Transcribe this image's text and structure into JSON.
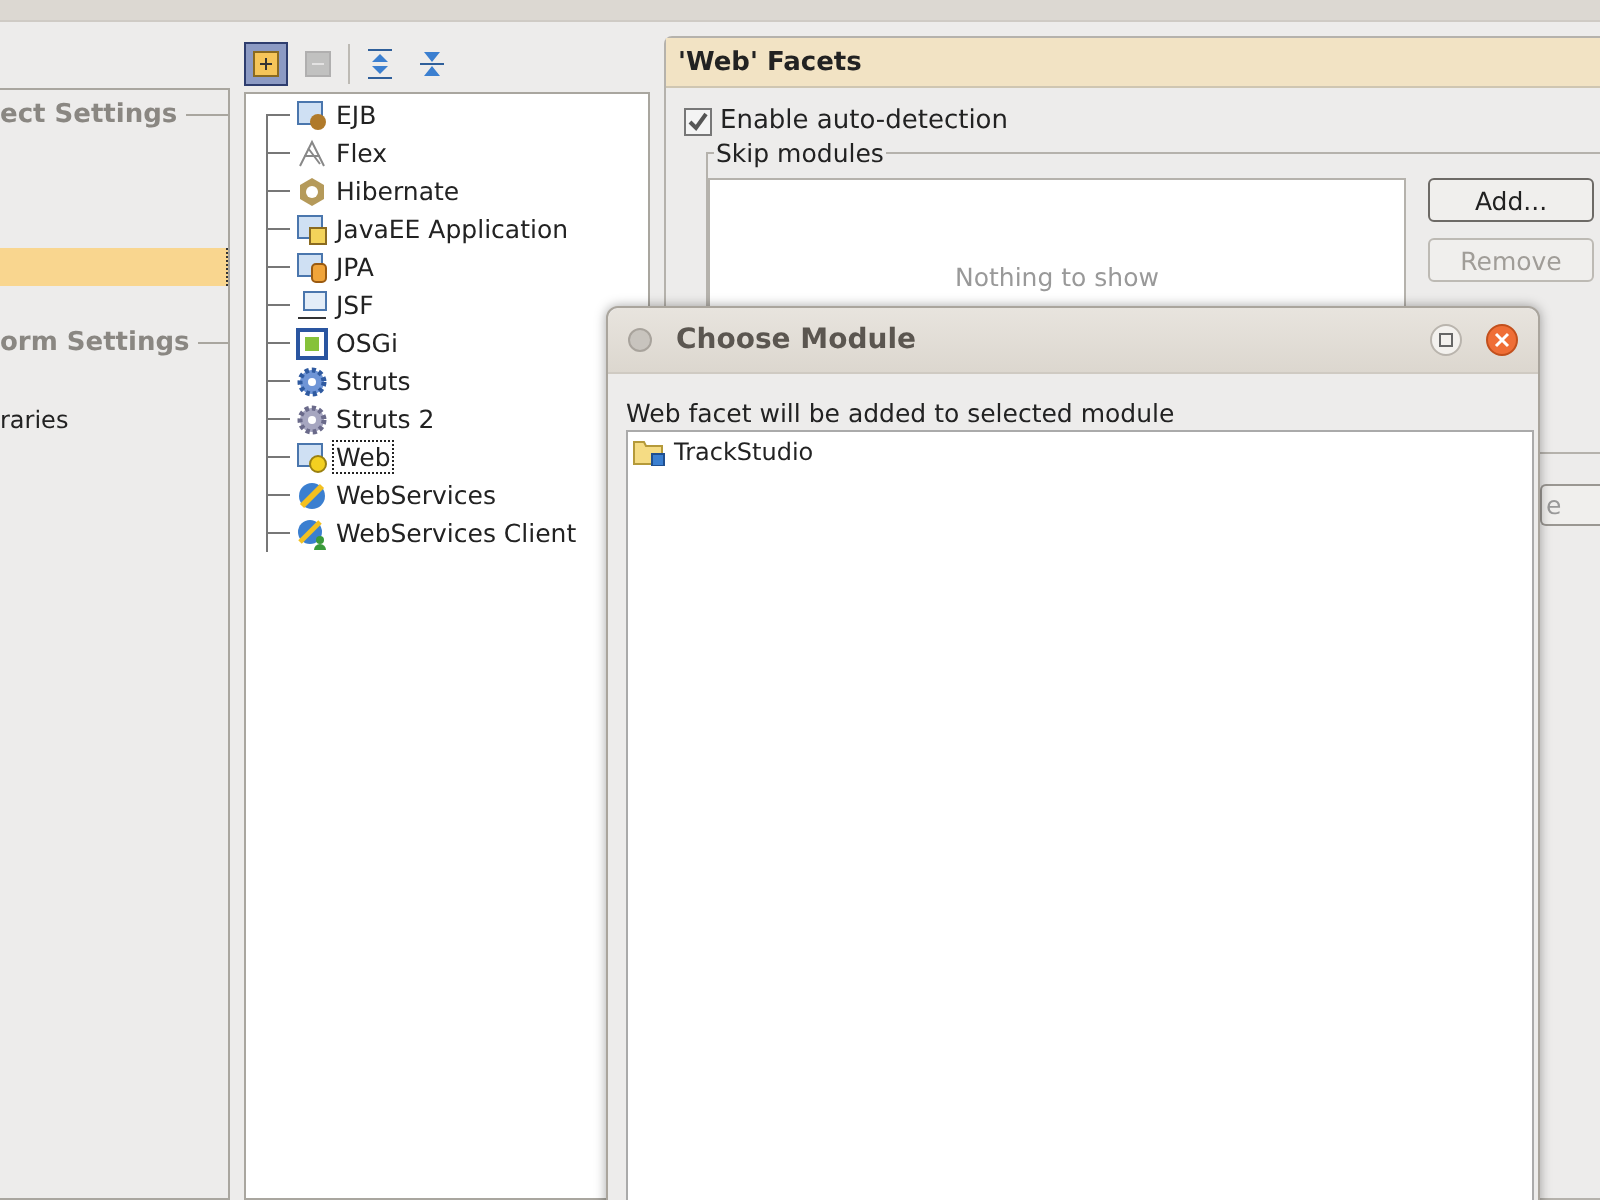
{
  "sidebar": {
    "rows": [
      {
        "kind": "heading",
        "label": "ect Settings"
      },
      {
        "kind": "spacer"
      },
      {
        "kind": "spacer"
      },
      {
        "kind": "spacer"
      },
      {
        "kind": "row",
        "selected": true
      },
      {
        "kind": "spacer"
      },
      {
        "kind": "heading",
        "label": "orm Settings"
      },
      {
        "kind": "spacer"
      },
      {
        "kind": "row",
        "label": "raries",
        "selected": false
      }
    ]
  },
  "toolbar": [
    {
      "kind": "add",
      "pressed": true,
      "disabled": false
    },
    {
      "kind": "remove",
      "pressed": false,
      "disabled": true
    },
    {
      "kind": "expand",
      "pressed": false,
      "disabled": false
    },
    {
      "kind": "collapse",
      "pressed": false,
      "disabled": false
    }
  ],
  "facet_tree": [
    {
      "label": "EJB",
      "focused": false
    },
    {
      "label": "Flex",
      "focused": false
    },
    {
      "label": "Hibernate",
      "focused": false
    },
    {
      "label": "JavaEE Application",
      "focused": false
    },
    {
      "label": "JPA",
      "focused": false
    },
    {
      "label": "JSF",
      "focused": false
    },
    {
      "label": "OSGi",
      "focused": false
    },
    {
      "label": "Struts",
      "focused": false
    },
    {
      "label": "Struts 2",
      "focused": false
    },
    {
      "label": "Web",
      "focused": true
    },
    {
      "label": "WebServices",
      "focused": false
    },
    {
      "label": "WebServices Client",
      "focused": false
    }
  ],
  "facets_panel": {
    "title": "'Web' Facets",
    "auto_detection": {
      "label": "Enable auto-detection",
      "checked": true
    },
    "skip_modules": {
      "legend": "Skip modules",
      "empty_text": "Nothing to show",
      "buttons": [
        {
          "label": "Add...",
          "disabled": false
        },
        {
          "label": "Remove",
          "disabled": true
        }
      ]
    },
    "partial_button": {
      "label": "e"
    }
  },
  "dialog": {
    "title": "Choose Module",
    "message": "Web facet will be added to selected module",
    "modules": [
      {
        "label": "TrackStudio",
        "selected": false
      }
    ]
  }
}
